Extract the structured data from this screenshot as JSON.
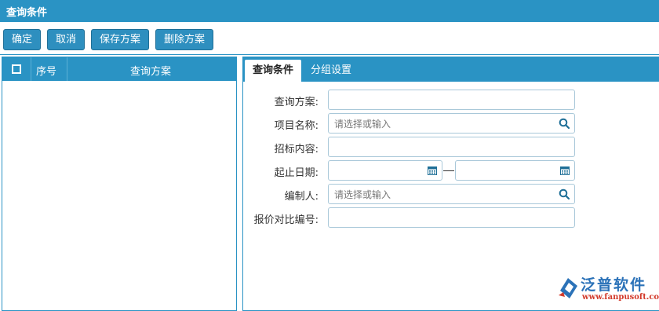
{
  "window": {
    "title": "查询条件"
  },
  "toolbar": {
    "confirm": "确定",
    "cancel": "取消",
    "save_scheme": "保存方案",
    "delete_scheme": "删除方案"
  },
  "scheme_list": {
    "columns": {
      "index": "序号",
      "scheme": "查询方案"
    },
    "rows": []
  },
  "tabs": [
    {
      "label": "查询条件",
      "active": true
    },
    {
      "label": "分组设置",
      "active": false
    }
  ],
  "form": {
    "scheme": {
      "label": "查询方案:",
      "value": ""
    },
    "project": {
      "label": "项目名称:",
      "placeholder": "请选择或输入",
      "icon": "search-icon"
    },
    "bid_content": {
      "label": "招标内容:",
      "value": ""
    },
    "date_range": {
      "label": "起止日期:",
      "start": "",
      "end": "",
      "icon": "calendar-icon"
    },
    "compiler": {
      "label": "编制人:",
      "placeholder": "请选择或输入",
      "icon": "search-icon"
    },
    "quote_no": {
      "label": "报价对比编号:",
      "value": ""
    }
  },
  "brand": {
    "name": "泛普软件",
    "url": "www.fanpusoft.com"
  },
  "colors": {
    "accent": "#2a93c4",
    "button": "#2e8fbf",
    "brand_blue": "#2b72b8",
    "brand_red": "#d23a2b"
  }
}
